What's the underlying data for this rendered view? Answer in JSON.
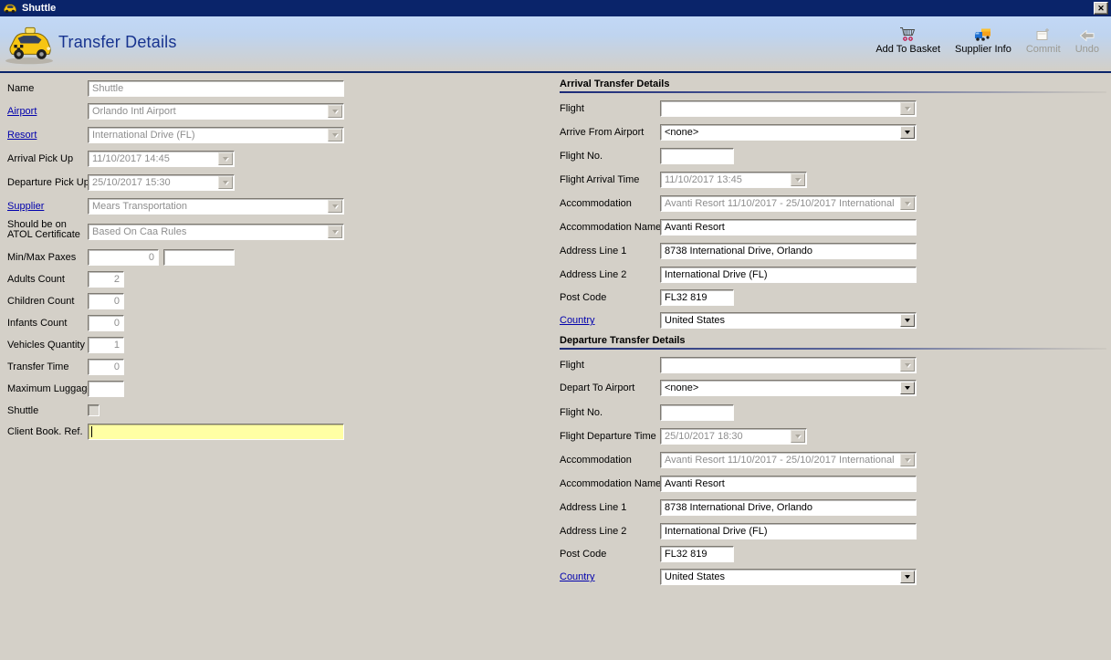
{
  "window": {
    "title": "Shuttle",
    "close_glyph": "✕"
  },
  "header": {
    "title": "Transfer Details"
  },
  "toolbar": {
    "items": [
      {
        "label": "Add To Basket",
        "icon": "cart-icon",
        "disabled": false
      },
      {
        "label": "Supplier Info",
        "icon": "truck-icon",
        "disabled": false
      },
      {
        "label": "Commit",
        "icon": "commit-icon",
        "disabled": true
      },
      {
        "label": "Undo",
        "icon": "undo-icon",
        "disabled": true
      }
    ]
  },
  "colors": {
    "titlebar": "#0a246a",
    "accent_navy": "#0a246a",
    "link": "#0202ad",
    "highlight_field": "#ffffa4",
    "body_bg": "#d4d0c8",
    "disabled_text": "#8e8e8e"
  },
  "left_form": {
    "rows": [
      {
        "label": "Name",
        "type": "text",
        "value": "Shuttle",
        "disabled": true,
        "size": "wide"
      },
      {
        "label": "Airport",
        "link": true,
        "type": "combo",
        "value": "Orlando Intl Airport",
        "disabled": true,
        "size": "wide"
      },
      {
        "label": "Resort",
        "link": true,
        "type": "combo",
        "value": "International Drive (FL)",
        "disabled": true,
        "size": "wide"
      },
      {
        "label": "Arrival Pick Up",
        "type": "combo",
        "value": "11/10/2017 14:45",
        "disabled": true,
        "size": "date"
      },
      {
        "label": "Departure Pick Up",
        "type": "combo",
        "value": "25/10/2017 15:30",
        "disabled": true,
        "size": "date"
      },
      {
        "label": "Supplier",
        "link": true,
        "type": "combo",
        "value": "Mears Transportation",
        "disabled": true,
        "size": "wide"
      },
      {
        "label": "Should be on",
        "label2": "ATOL Certificate",
        "type": "combo",
        "value": "Based On Caa Rules",
        "disabled": true,
        "size": "wide"
      },
      {
        "label": "Min/Max Paxes",
        "type": "minmax",
        "value": "0",
        "value2": "",
        "disabled": true
      },
      {
        "label": "Adults Count",
        "type": "num",
        "value": "2",
        "disabled": true
      },
      {
        "label": "Children Count",
        "type": "num",
        "value": "0",
        "disabled": true
      },
      {
        "label": "Infants Count",
        "type": "num",
        "value": "0",
        "disabled": true
      },
      {
        "label": "Vehicles Quantity",
        "type": "num",
        "value": "1",
        "disabled": true
      },
      {
        "label": "Transfer Time",
        "type": "num",
        "value": "0",
        "disabled": true
      },
      {
        "label": "Maximum Luggage",
        "type": "num",
        "value": "",
        "disabled": false
      },
      {
        "label": "Shuttle",
        "type": "checkbox",
        "checked": false,
        "disabled": true
      },
      {
        "label": "Client Book. Ref.",
        "type": "yellowtext",
        "value": "",
        "disabled": false
      }
    ]
  },
  "right_sections": [
    {
      "title": "Arrival Transfer Details",
      "rows": [
        {
          "label": "Flight",
          "type": "combo",
          "value": "",
          "disabled": true,
          "size": "wide"
        },
        {
          "label": "Arrive From Airport",
          "type": "combo",
          "value": "<none>",
          "disabled": false,
          "size": "wide"
        },
        {
          "label": "Flight No.",
          "type": "text",
          "value": "",
          "disabled": false,
          "size": "short"
        },
        {
          "label": "Flight Arrival Time",
          "type": "combo",
          "value": "11/10/2017 13:45",
          "disabled": true,
          "size": "date"
        },
        {
          "label": "Accommodation",
          "type": "combo",
          "value": "Avanti Resort 11/10/2017 - 25/10/2017 International",
          "disabled": true,
          "size": "wide"
        },
        {
          "label": "Accommodation Name",
          "type": "text",
          "value": "Avanti Resort",
          "disabled": false,
          "size": "wide"
        },
        {
          "label": "Address Line 1",
          "type": "text",
          "value": "8738 International Drive, Orlando",
          "disabled": false,
          "size": "wide"
        },
        {
          "label": "Address Line 2",
          "type": "text",
          "value": "International Drive (FL)",
          "disabled": false,
          "size": "wide"
        },
        {
          "label": "Post Code",
          "type": "text",
          "value": "FL32 819",
          "disabled": false,
          "size": "short"
        },
        {
          "label": "Country",
          "link": true,
          "type": "combo",
          "value": "United States",
          "disabled": false,
          "size": "wide"
        }
      ]
    },
    {
      "title": "Departure Transfer Details",
      "rows": [
        {
          "label": "Flight",
          "type": "combo",
          "value": "",
          "disabled": true,
          "size": "wide"
        },
        {
          "label": "Depart To Airport",
          "type": "combo",
          "value": "<none>",
          "disabled": false,
          "size": "wide"
        },
        {
          "label": "Flight No.",
          "type": "text",
          "value": "",
          "disabled": false,
          "size": "short"
        },
        {
          "label": "Flight Departure Time",
          "type": "combo",
          "value": "25/10/2017 18:30",
          "disabled": true,
          "size": "date"
        },
        {
          "label": "Accommodation",
          "type": "combo",
          "value": "Avanti Resort 11/10/2017 - 25/10/2017 International",
          "disabled": true,
          "size": "wide"
        },
        {
          "label": "Accommodation Name",
          "type": "text",
          "value": "Avanti Resort",
          "disabled": false,
          "size": "wide"
        },
        {
          "label": "Address Line 1",
          "type": "text",
          "value": "8738 International Drive, Orlando",
          "disabled": false,
          "size": "wide"
        },
        {
          "label": "Address Line 2",
          "type": "text",
          "value": "International Drive (FL)",
          "disabled": false,
          "size": "wide"
        },
        {
          "label": "Post Code",
          "type": "text",
          "value": "FL32 819",
          "disabled": false,
          "size": "short"
        },
        {
          "label": "Country",
          "link": true,
          "type": "combo",
          "value": "United States",
          "disabled": false,
          "size": "wide"
        }
      ]
    }
  ]
}
